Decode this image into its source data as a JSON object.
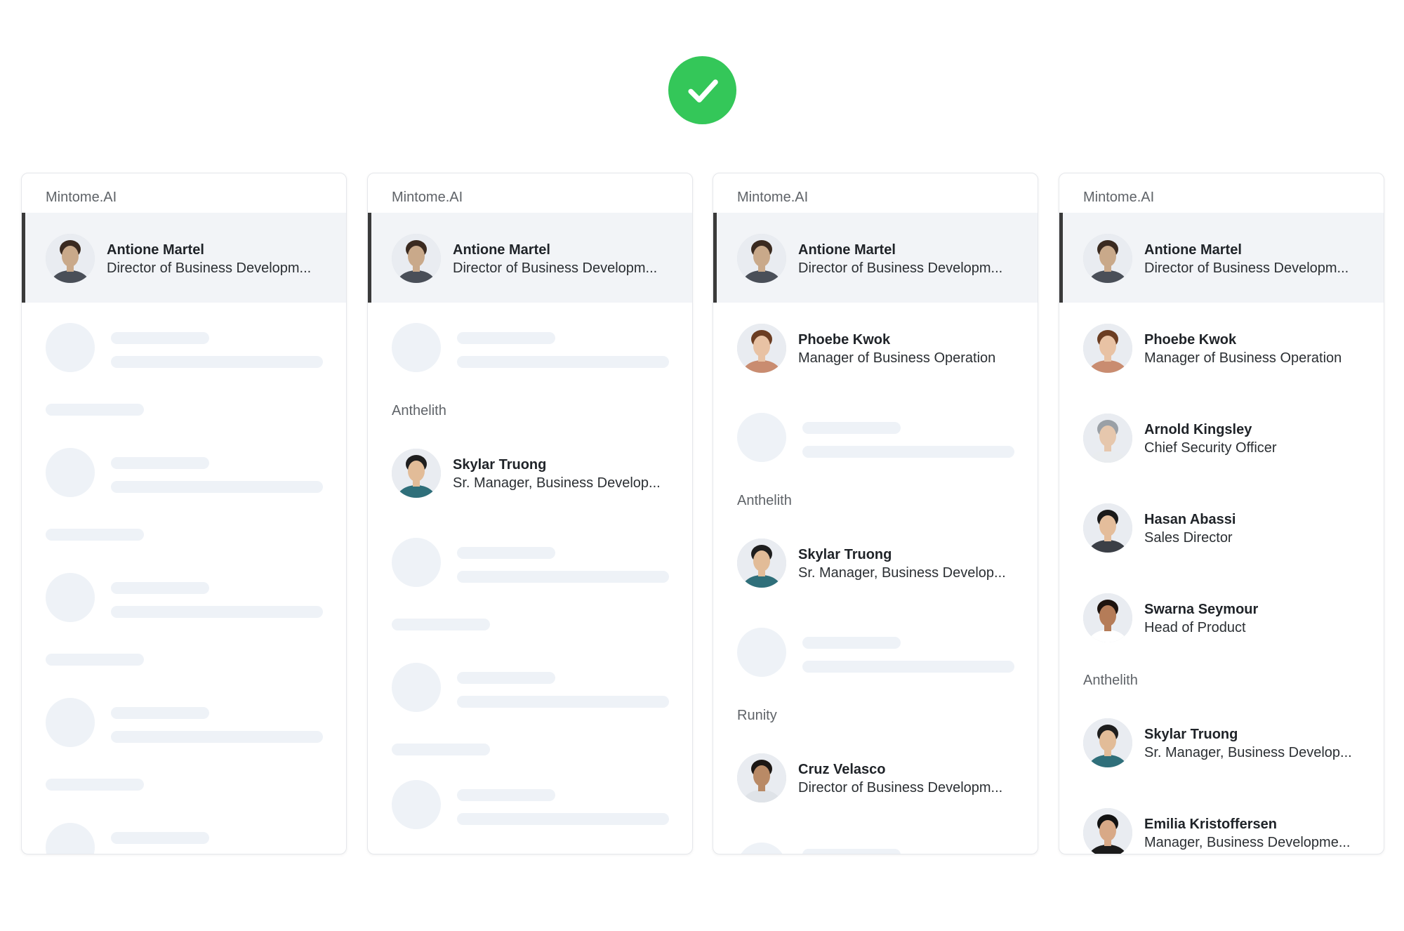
{
  "status": {
    "icon": "check-circle-icon",
    "color": "#34c759"
  },
  "colors": {
    "selected_bg": "#f2f4f7",
    "selected_bar": "#3a3a3a",
    "skeleton": "#eef2f7"
  },
  "cards": [
    {
      "company": "Mintome.AI",
      "contacts": [
        {
          "name": "Antione Martel",
          "title": "Director of Business Developm...",
          "selected": true
        }
      ]
    },
    {
      "company": "Mintome.AI",
      "contacts": [
        {
          "name": "Antione Martel",
          "title": "Director of Business Developm...",
          "selected": true
        }
      ],
      "group2": {
        "company": "Anthelith",
        "contacts": [
          {
            "name": "Skylar Truong",
            "title": "Sr. Manager, Business Develop..."
          }
        ]
      }
    },
    {
      "company": "Mintome.AI",
      "contacts": [
        {
          "name": "Antione Martel",
          "title": "Director of Business Developm...",
          "selected": true
        },
        {
          "name": "Phoebe Kwok",
          "title": "Manager of Business Operation"
        }
      ],
      "group2": {
        "company": "Anthelith",
        "contacts": [
          {
            "name": "Skylar Truong",
            "title": "Sr. Manager, Business Develop..."
          }
        ]
      },
      "group3": {
        "company": "Runity",
        "contacts": [
          {
            "name": "Cruz Velasco",
            "title": "Director of Business Developm..."
          }
        ]
      }
    },
    {
      "company": "Mintome.AI",
      "contacts": [
        {
          "name": "Antione Martel",
          "title": "Director of Business Developm...",
          "selected": true
        },
        {
          "name": "Phoebe Kwok",
          "title": "Manager of Business Operation"
        },
        {
          "name": "Arnold Kingsley",
          "title": "Chief Security Officer"
        },
        {
          "name": "Hasan Abassi",
          "title": "Sales Director"
        },
        {
          "name": "Swarna Seymour",
          "title": "Head of Product"
        }
      ],
      "group2": {
        "company": "Anthelith",
        "contacts": [
          {
            "name": "Skylar Truong",
            "title": "Sr. Manager, Business Develop..."
          },
          {
            "name": "Emilia Kristoffersen",
            "title": "Manager, Business Developme..."
          }
        ]
      }
    }
  ]
}
